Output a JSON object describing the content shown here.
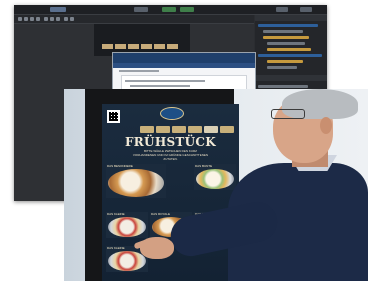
{
  "editor": {
    "title_left": "",
    "title_right": "",
    "dialog_title": "",
    "dialog_subtitle": ""
  },
  "kiosk": {
    "heading": "FRÜHSTÜCK",
    "tagline": "BITTE WÄHLE ZWISCHEN DEN KURZ VORHANDENEN UND IM GRÜNDE GESCHNITTENEN ZUTATEN.",
    "menu_items": [
      {
        "name": "DAS BESONDERE"
      },
      {
        "name": "DAS BUNTE"
      },
      {
        "name": "DAS KLEINE"
      },
      {
        "name": "DAS ROYALE"
      },
      {
        "name": "DAS BUNTE"
      },
      {
        "name": "DAS KLEINE"
      }
    ]
  },
  "colors": {
    "editor_bg": "#2b2d31",
    "dialog_header": "#1f3f6b",
    "screen_bg": "#1b2c3f",
    "accent_gold": "#c8b07a",
    "heading_text": "#f2ead7"
  }
}
